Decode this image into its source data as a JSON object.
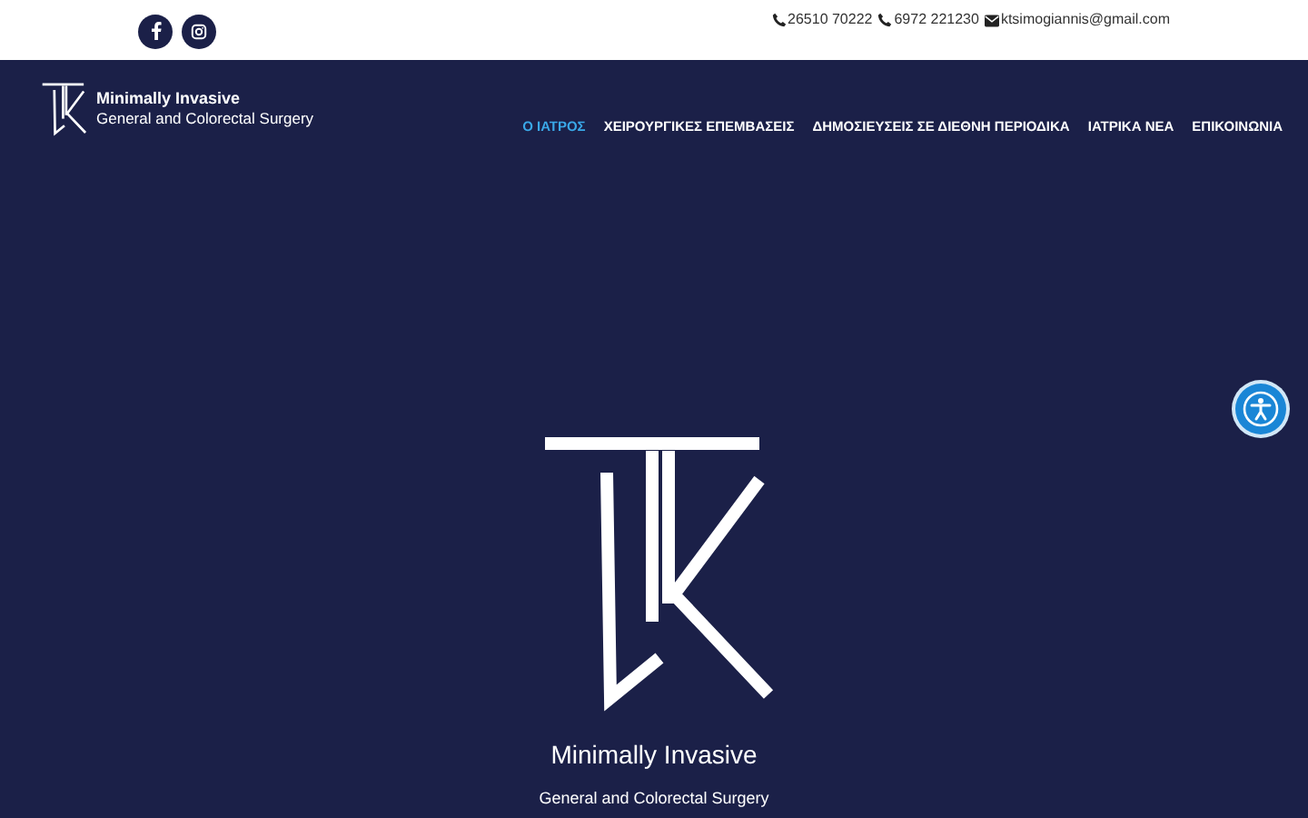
{
  "top_bar": {
    "social": [
      {
        "kind": "facebook"
      },
      {
        "kind": "instagram"
      }
    ],
    "contacts": [
      {
        "kind": "phone",
        "text": "26510 70222"
      },
      {
        "kind": "phone",
        "text": "6972 221230"
      },
      {
        "kind": "email",
        "text": "ktsimogiannis@gmail.com"
      }
    ]
  },
  "header": {
    "brand_line_1": "Minimally Invasive",
    "brand_line_2": "General and Colorectal Surgery",
    "nav": [
      {
        "label": "Ο ΙΑΤΡΟΣ",
        "selected": true
      },
      {
        "label": "ΧΕΙΡΟΥΡΓΙΚΕΣ ΕΠΕΜΒΑΣΕΙΣ",
        "selected": false
      },
      {
        "label": "ΔΗΜΟΣΙΕΥΣΕΙΣ ΣΕ ΔΙΕΘΝΗ ΠΕΡΙΟΔΙΚΑ",
        "selected": false
      },
      {
        "label": "ΙΑΤΡΙΚΑ ΝΕΑ",
        "selected": false
      },
      {
        "label": "ΕΠΙΚΟΙΝΩΝΙΑ",
        "selected": false
      }
    ]
  },
  "hero": {
    "title": "Minimally Invasive",
    "subtitle": "General and Colorectal Surgery"
  }
}
